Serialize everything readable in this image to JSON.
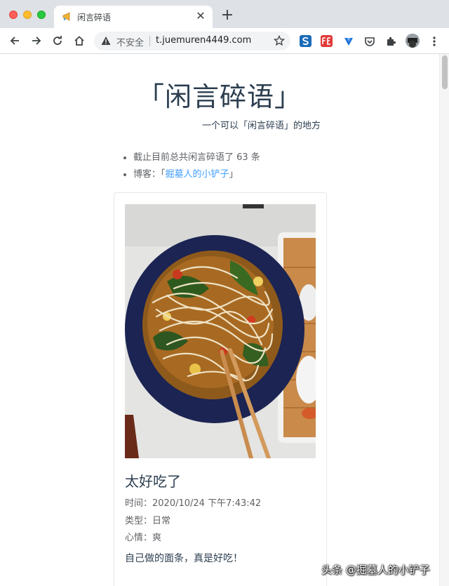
{
  "browser": {
    "tab": {
      "title": "闲言碎语",
      "favicon": "megaphone-icon",
      "close": "✕"
    },
    "new_tab": "+",
    "omnibox": {
      "security_label": "不安全",
      "url": "t.juemuren4449.com"
    },
    "extensions": [
      "s-extension-icon",
      "fe-extension-icon",
      "v-extension-icon",
      "pocket-icon",
      "puzzle-icon",
      "profile-avatar",
      "menu-icon"
    ]
  },
  "page": {
    "title": "「闲言碎语」",
    "subtitle": "一个可以「闲言碎语」的地方",
    "stats": "截止目前总共闲言碎语了 63 条",
    "blog_label": "博客：",
    "blog_link_open": "「",
    "blog_link": "掘墓人的小铲子",
    "blog_link_close": "」"
  },
  "post": {
    "title": "太好吃了",
    "time": "时间：2020/10/24 下午7:43:42",
    "category": "类型：日常",
    "mood": "心情：爽",
    "content": "自己做的面条，真是好吃！",
    "image": "noodle-soup-photo"
  },
  "watermark": "头条 @掘墓人的小铲子",
  "colors": {
    "title": "#2c3e50",
    "text": "#606266",
    "link": "#409eff",
    "bowl": "#1f2a5c",
    "chrome": "#dee1e6"
  }
}
